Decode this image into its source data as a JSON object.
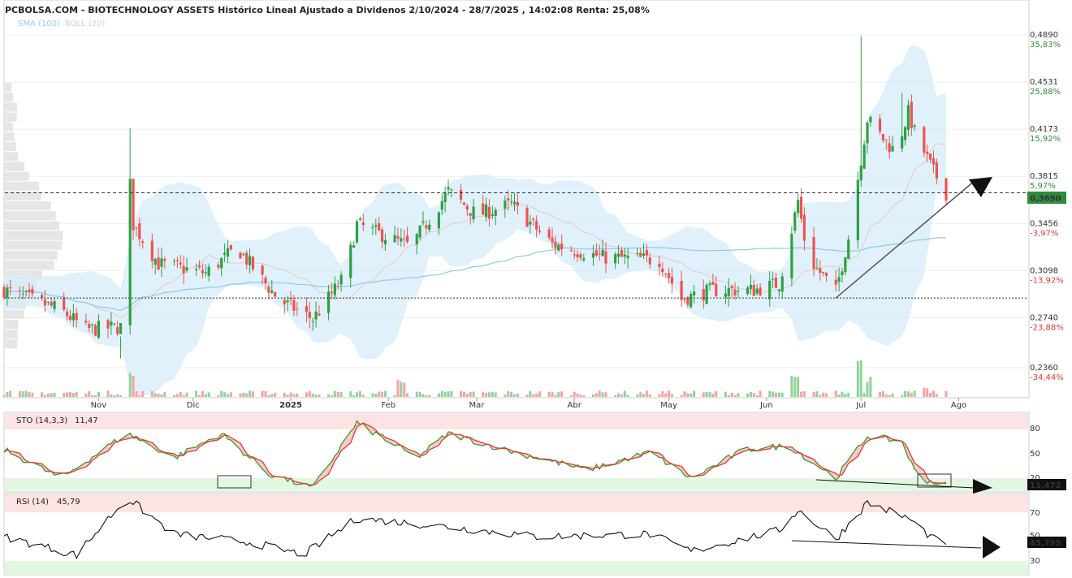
{
  "header": {
    "title": "PCBOLSA.COM - BIOTECHNOLOGY ASSETS Histórico Lineal Ajustado a Dividenos 2/10/2024 - 28/7/2025 , 14:02:08 Renta: 25,08%",
    "legend_sma": "SMA (100)",
    "legend_boll": "BOLL (20)"
  },
  "price_axis": {
    "levels": [
      {
        "price": "0,4890",
        "pct": "35,83%",
        "sign": "pos"
      },
      {
        "price": "0,4531",
        "pct": "25,88%",
        "sign": "pos"
      },
      {
        "price": "0,4173",
        "pct": "15,92%",
        "sign": "pos"
      },
      {
        "price": "0,3815",
        "pct": "5,97%",
        "sign": "pos"
      },
      {
        "price": "0,3456",
        "pct": "-3,97%",
        "sign": "neg"
      },
      {
        "price": "0,3098",
        "pct": "-13,92%",
        "sign": "neg"
      },
      {
        "price": "0,2740",
        "pct": "-23,88%",
        "sign": "neg"
      },
      {
        "price": "0,2360",
        "pct": "-34,44%",
        "sign": "neg"
      }
    ],
    "current_label": "0,3690"
  },
  "months": [
    "Nov",
    "Dic",
    "2025",
    "Feb",
    "Mar",
    "Abr",
    "May",
    "Jun",
    "Jul",
    "Ago"
  ],
  "sto": {
    "label": "STO (14,3,3)",
    "value": "11,47",
    "current_label": "11,472",
    "levels": [
      "80",
      "50",
      "20"
    ]
  },
  "rsi": {
    "label": "RSI (14)",
    "value": "45,79",
    "current_label": "45,795",
    "levels": [
      "70",
      "50",
      "30"
    ]
  },
  "colors": {
    "up": "#2ea043",
    "down": "#ef5350",
    "band_fill": "#d6ecfa",
    "sma": "#8ecae6",
    "sto_k": "#3a9b2c",
    "sto_d": "#e53935",
    "rsi_line": "#111111",
    "overbought_bg": "#fde4e4",
    "oversold_bg": "#e2f7e2",
    "current_bg": "#2e8b3d"
  },
  "chart_data": {
    "type": "candlestick",
    "title": "PCBOLSA.COM - BIOTECHNOLOGY ASSETS Histórico Lineal Ajustado a Dividenos 2/10/2024 - 28/7/2025 , 14:02:08 Renta: 25,08%",
    "x_range": [
      "2024-10-02",
      "2025-07-28"
    ],
    "y_range": [
      0.23,
      0.5
    ],
    "last_close": 0.369,
    "yield_pct": 25.08,
    "reference_level": 0.289,
    "trendline": {
      "from": [
        "2025-06-23",
        0.289
      ],
      "to": [
        "2025-08-06",
        0.378
      ]
    },
    "ohlc_anchors": [
      {
        "date": "2024-10-02",
        "close": 0.295
      },
      {
        "date": "2024-10-20",
        "close": 0.28
      },
      {
        "date": "2024-10-28",
        "close": 0.265
      },
      {
        "date": "2024-11-08",
        "close": 0.267
      },
      {
        "date": "2024-11-10",
        "close": 0.405
      },
      {
        "date": "2024-11-12",
        "close": 0.345
      },
      {
        "date": "2024-11-20",
        "close": 0.315
      },
      {
        "date": "2024-12-05",
        "close": 0.308
      },
      {
        "date": "2024-12-15",
        "close": 0.327
      },
      {
        "date": "2024-12-28",
        "close": 0.288
      },
      {
        "date": "2025-01-08",
        "close": 0.273
      },
      {
        "date": "2025-01-18",
        "close": 0.305
      },
      {
        "date": "2025-01-22",
        "close": 0.345
      },
      {
        "date": "2025-02-08",
        "close": 0.328
      },
      {
        "date": "2025-02-20",
        "close": 0.37
      },
      {
        "date": "2025-03-01",
        "close": 0.352
      },
      {
        "date": "2025-03-12",
        "close": 0.36
      },
      {
        "date": "2025-03-25",
        "close": 0.33
      },
      {
        "date": "2025-04-10",
        "close": 0.32
      },
      {
        "date": "2025-04-28",
        "close": 0.318
      },
      {
        "date": "2025-05-05",
        "close": 0.288
      },
      {
        "date": "2025-05-15",
        "close": 0.295
      },
      {
        "date": "2025-05-28",
        "close": 0.295
      },
      {
        "date": "2025-06-05",
        "close": 0.3
      },
      {
        "date": "2025-06-08",
        "close": 0.33
      },
      {
        "date": "2025-06-11",
        "close": 0.363
      },
      {
        "date": "2025-06-14",
        "close": 0.32
      },
      {
        "date": "2025-06-23",
        "close": 0.294
      },
      {
        "date": "2025-06-27",
        "close": 0.335
      },
      {
        "date": "2025-06-30",
        "close": 0.38
      },
      {
        "date": "2025-07-03",
        "close": 0.425
      },
      {
        "date": "2025-07-08",
        "close": 0.41
      },
      {
        "date": "2025-07-12",
        "close": 0.4
      },
      {
        "date": "2025-07-16",
        "close": 0.43
      },
      {
        "date": "2025-07-18",
        "close": 0.415
      },
      {
        "date": "2025-07-24",
        "close": 0.385
      },
      {
        "date": "2025-07-28",
        "close": 0.369
      }
    ],
    "sto_anchors": [
      {
        "date": "2024-10-02",
        "k": 55
      },
      {
        "date": "2024-10-20",
        "k": 20
      },
      {
        "date": "2024-11-10",
        "k": 75
      },
      {
        "date": "2024-11-25",
        "k": 45
      },
      {
        "date": "2024-12-10",
        "k": 75
      },
      {
        "date": "2024-12-25",
        "k": 25
      },
      {
        "date": "2025-01-08",
        "k": 8
      },
      {
        "date": "2025-01-22",
        "k": 88
      },
      {
        "date": "2025-02-10",
        "k": 45
      },
      {
        "date": "2025-02-20",
        "k": 75
      },
      {
        "date": "2025-03-10",
        "k": 55
      },
      {
        "date": "2025-04-05",
        "k": 30
      },
      {
        "date": "2025-04-25",
        "k": 52
      },
      {
        "date": "2025-05-08",
        "k": 20
      },
      {
        "date": "2025-05-25",
        "k": 55
      },
      {
        "date": "2025-06-08",
        "k": 60
      },
      {
        "date": "2025-06-23",
        "k": 20
      },
      {
        "date": "2025-07-03",
        "k": 72
      },
      {
        "date": "2025-07-14",
        "k": 65
      },
      {
        "date": "2025-07-19",
        "k": 20
      },
      {
        "date": "2025-07-28",
        "k": 11.47
      }
    ],
    "rsi_anchors": [
      {
        "date": "2024-10-02",
        "v": 50
      },
      {
        "date": "2024-10-25",
        "v": 35
      },
      {
        "date": "2024-11-10",
        "v": 82
      },
      {
        "date": "2024-11-25",
        "v": 52
      },
      {
        "date": "2024-12-20",
        "v": 45
      },
      {
        "date": "2025-01-05",
        "v": 35
      },
      {
        "date": "2025-01-22",
        "v": 65
      },
      {
        "date": "2025-02-20",
        "v": 58
      },
      {
        "date": "2025-03-20",
        "v": 50
      },
      {
        "date": "2025-04-25",
        "v": 52
      },
      {
        "date": "2025-05-08",
        "v": 38
      },
      {
        "date": "2025-06-05",
        "v": 55
      },
      {
        "date": "2025-06-11",
        "v": 72
      },
      {
        "date": "2025-06-23",
        "v": 48
      },
      {
        "date": "2025-07-03",
        "v": 78
      },
      {
        "date": "2025-07-16",
        "v": 65
      },
      {
        "date": "2025-07-24",
        "v": 48
      },
      {
        "date": "2025-07-28",
        "v": 45.79
      }
    ]
  }
}
